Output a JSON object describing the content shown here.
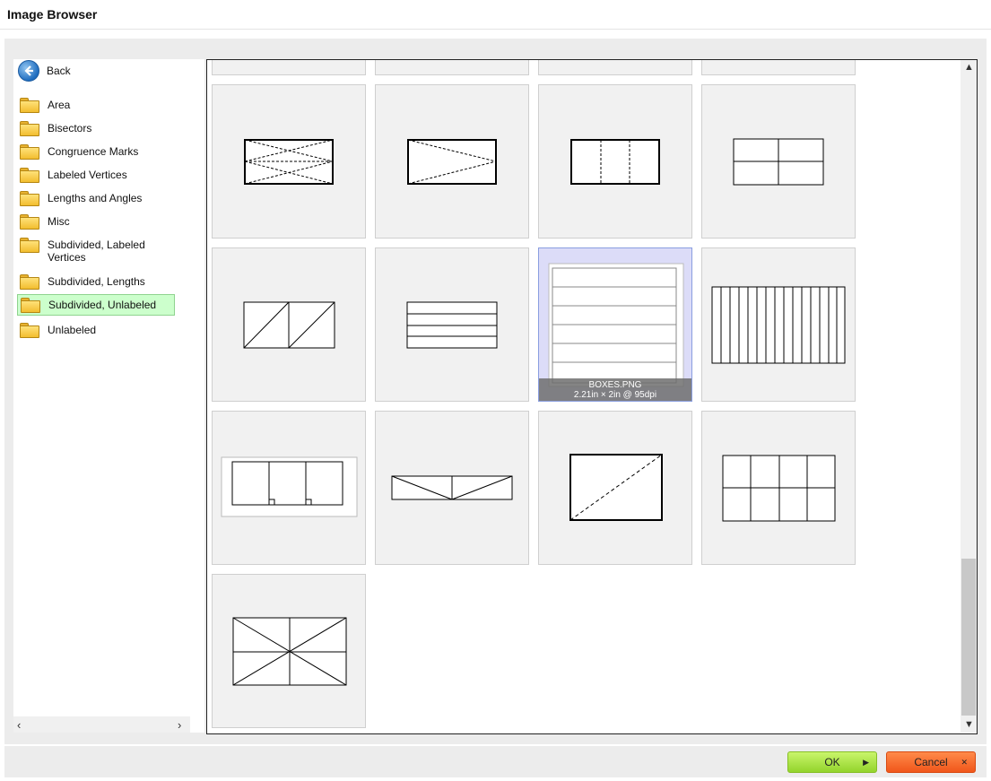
{
  "window": {
    "title": "Image Browser"
  },
  "tree": {
    "back_label": "Back",
    "items": [
      {
        "label": "Area"
      },
      {
        "label": "Bisectors"
      },
      {
        "label": "Congruence Marks"
      },
      {
        "label": "Labeled Vertices"
      },
      {
        "label": "Lengths and Angles"
      },
      {
        "label": "Misc"
      },
      {
        "label": "Subdivided, Labeled Vertices"
      },
      {
        "label": "Subdivided, Lengths"
      },
      {
        "label": "Subdivided, Unlabeled",
        "selected": true
      },
      {
        "label": "Unlabeled"
      }
    ]
  },
  "grid": {
    "selected_caption": {
      "name": "BOXES.PNG",
      "details": "2.21in × 2in @ 95dpi"
    }
  },
  "footer": {
    "ok_label": "OK",
    "cancel_label": "Cancel"
  },
  "colors": {
    "selected_folder": "#ccffcc",
    "ok": "#93d42c",
    "cancel": "#f0561a",
    "selected_thumb": "#dcdcf8"
  }
}
